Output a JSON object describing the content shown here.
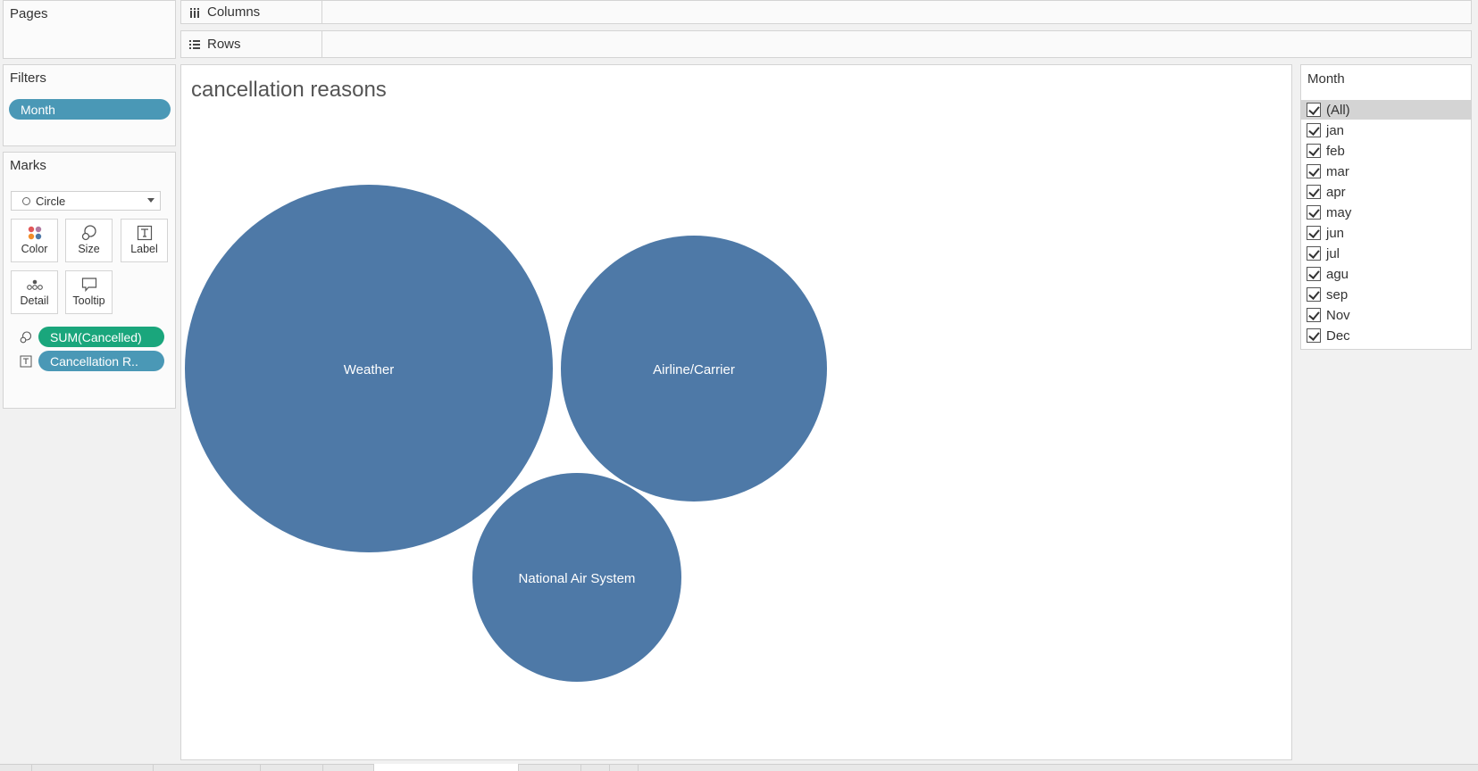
{
  "pages": {
    "title": "Pages"
  },
  "columns_shelf": {
    "label": "Columns"
  },
  "rows_shelf": {
    "label": "Rows"
  },
  "filters": {
    "title": "Filters",
    "pill": "Month"
  },
  "marks": {
    "title": "Marks",
    "mark_type": "Circle",
    "buttons": {
      "color": "Color",
      "size": "Size",
      "label": "Label",
      "detail": "Detail",
      "tooltip": "Tooltip"
    },
    "fields": {
      "size_field": "SUM(Cancelled)",
      "label_field": "Cancellation R.."
    }
  },
  "chart_data": {
    "type": "bubble",
    "title": "cancellation reasons",
    "categories": [
      "Weather",
      "Airline/Carrier",
      "National Air System"
    ],
    "color": "#4e79a7"
  },
  "month_filter": {
    "title": "Month",
    "items": [
      "(All)",
      "jan",
      "feb",
      "mar",
      "apr",
      "may",
      "jun",
      "jul",
      "agu",
      "sep",
      "Nov",
      "Dec"
    ]
  },
  "colors": {
    "pill_blue": "#4a98b6",
    "pill_green": "#1aa67c",
    "mark_color": "#4e79a7"
  }
}
